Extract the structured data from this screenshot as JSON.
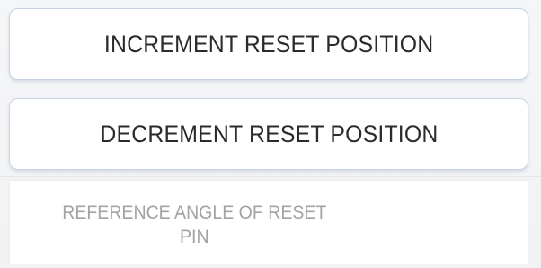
{
  "controls": {
    "increment_button_label": "INCREMENT RESET POSITION",
    "decrement_button_label": "DECREMENT RESET POSITION"
  },
  "readout": {
    "label_line1": "REFERENCE ANGLE OF RESET",
    "label_line2": "PIN"
  },
  "colors": {
    "button_border": "#c9d3e6",
    "button_text": "#2b2b2b",
    "readout_text": "#a3a3a3",
    "background": "#f3f3f3"
  }
}
